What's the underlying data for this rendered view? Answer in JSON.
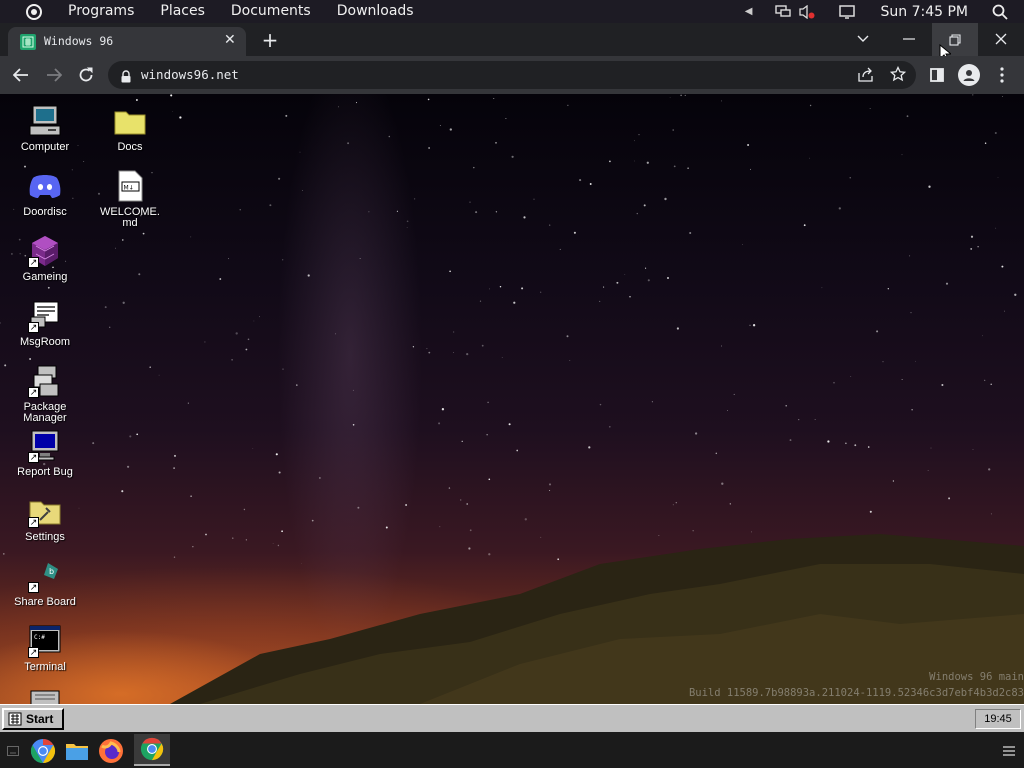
{
  "top_panel": {
    "menus": [
      "Programs",
      "Places",
      "Documents",
      "Downloads"
    ],
    "clock": "Sun 7:45 PM"
  },
  "browser": {
    "tab": {
      "title": "Windows 96"
    },
    "url": "windows96.net"
  },
  "desktop": {
    "icons_left": [
      {
        "label": "Computer",
        "icon": "computer-icon"
      },
      {
        "label": "Doordisc",
        "icon": "discord-icon"
      },
      {
        "label": "Gameing",
        "icon": "cube-icon"
      },
      {
        "label": "MsgRoom",
        "icon": "msgroom-icon"
      },
      {
        "label": "Package Manager",
        "icon": "package-icon"
      },
      {
        "label": "Report Bug",
        "icon": "monitor-bug-icon"
      },
      {
        "label": "Settings",
        "icon": "settings-folder-icon"
      },
      {
        "label": "Share Board",
        "icon": "share-board-icon"
      },
      {
        "label": "Terminal",
        "icon": "terminal-icon"
      }
    ],
    "icons_right": [
      {
        "label": "Docs",
        "icon": "folder-icon"
      },
      {
        "label": "WELCOME.md",
        "icon": "markdown-file-icon"
      }
    ],
    "watermark_line1": "Windows 96 main",
    "watermark_line2": "Build 11589.7b98893a.211024-1119.52346c3d7ebf4b3d2c83"
  },
  "w96_taskbar": {
    "start_label": "Start",
    "clock": "19:45"
  },
  "colors": {
    "panel_bg": "#1d1b24",
    "chrome_tab_bg": "#35363a",
    "chrome_frame_bg": "#202124",
    "w96_gray": "#c0c0c0"
  }
}
